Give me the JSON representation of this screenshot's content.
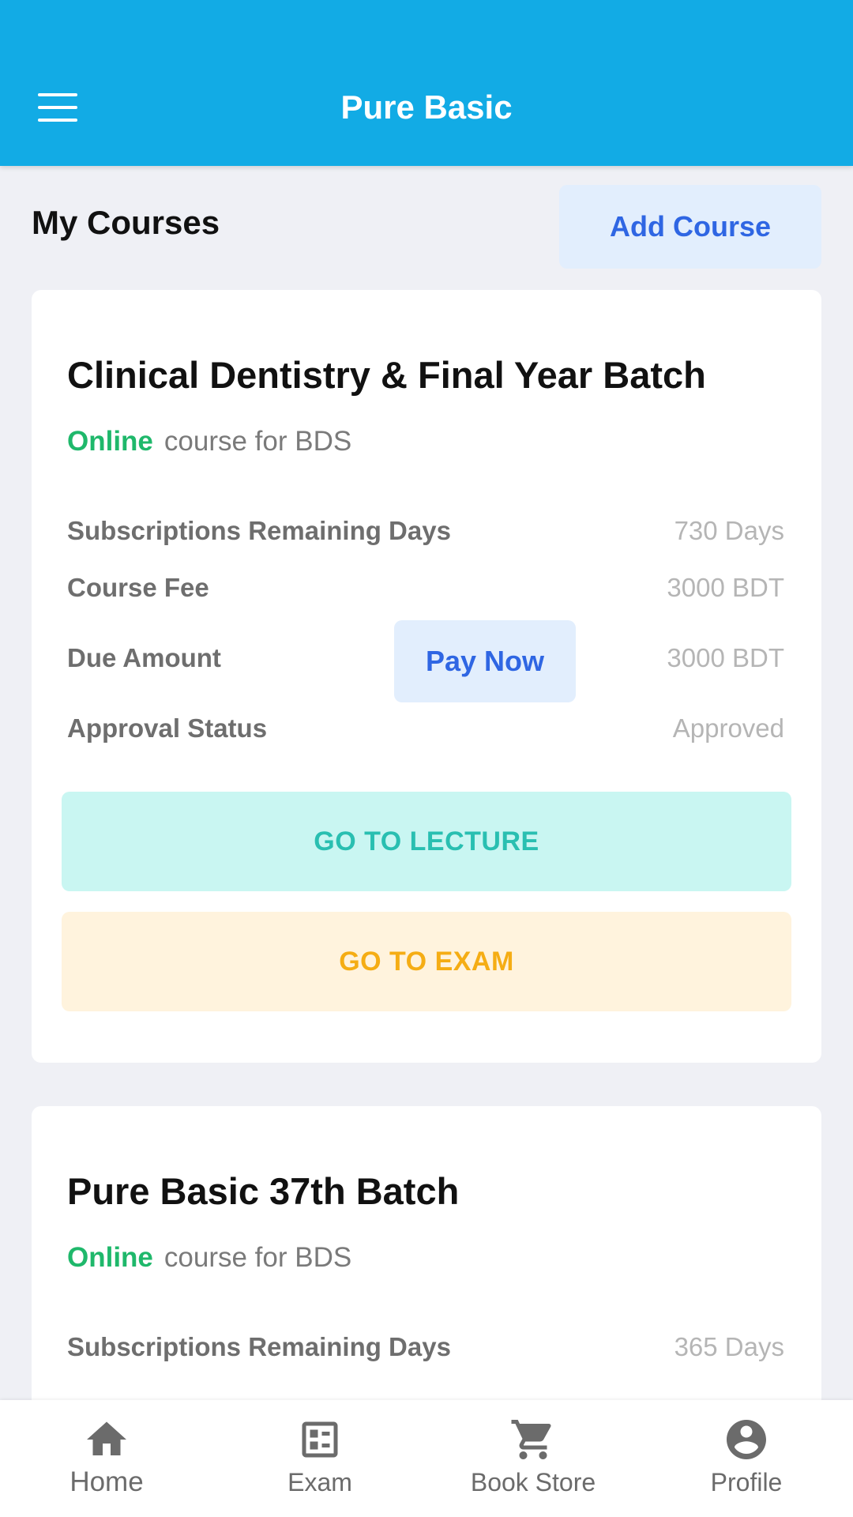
{
  "app_bar": {
    "title": "Pure Basic",
    "menu_icon": "hamburger-menu-icon"
  },
  "section": {
    "title": "My Courses",
    "add_course_label": "Add Course"
  },
  "courses": [
    {
      "title": "Clinical Dentistry & Final Year Batch",
      "mode": "Online",
      "subtitle": "course for BDS",
      "rows": [
        {
          "label": "Subscriptions Remaining Days",
          "value": "730 Days"
        },
        {
          "label": "Course Fee",
          "value": "3000 BDT"
        },
        {
          "label": "Due Amount",
          "value": "3000 BDT"
        },
        {
          "label": "Approval Status",
          "value": "Approved"
        }
      ],
      "pay_now_label": "Pay Now",
      "lecture_label": "GO TO LECTURE",
      "exam_label": "GO TO EXAM"
    },
    {
      "title": "Pure Basic 37th Batch",
      "mode": "Online",
      "subtitle": "course for BDS",
      "rows": [
        {
          "label": "Subscriptions Remaining Days",
          "value": "365 Days"
        }
      ]
    }
  ],
  "bottom_nav": [
    {
      "label": "Home",
      "icon": "home-icon",
      "active": true
    },
    {
      "label": "Exam",
      "icon": "exam-icon"
    },
    {
      "label": "Book Store",
      "icon": "cart-icon"
    },
    {
      "label": "Profile",
      "icon": "profile-icon"
    }
  ],
  "colors": {
    "app_bar": "#12abe5",
    "online": "#1fb86b",
    "link_blue": "#2f66e3",
    "lecture_text": "#29bfb1",
    "exam_text": "#f5ad14"
  }
}
